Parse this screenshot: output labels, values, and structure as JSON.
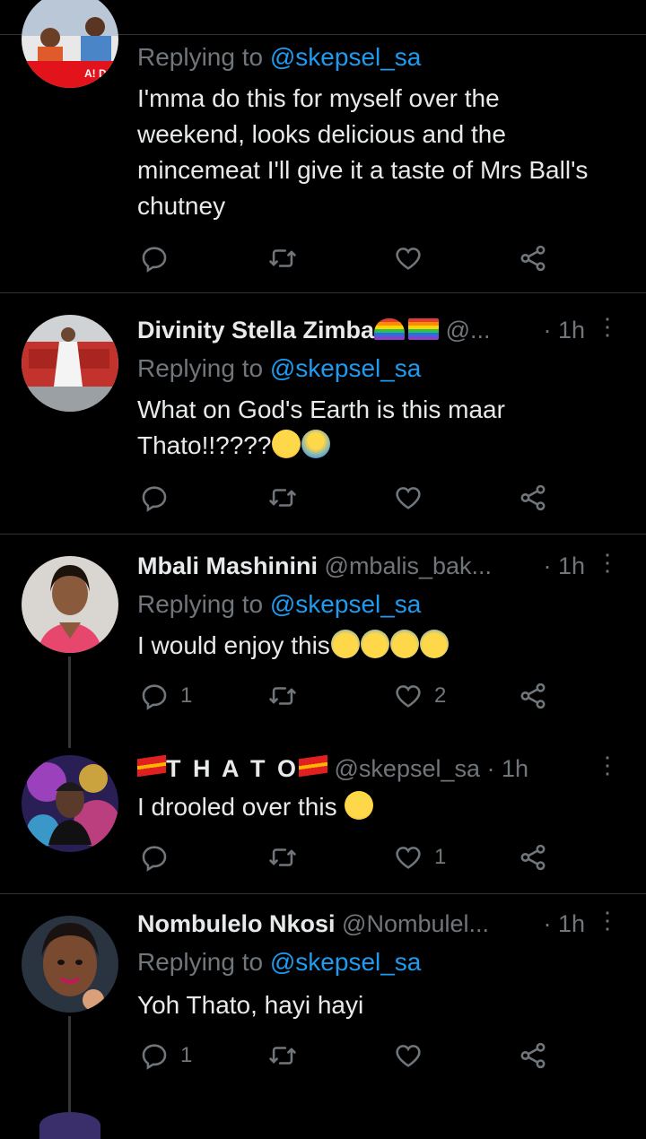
{
  "tweets": [
    {
      "reply_prefix": "Replying to ",
      "reply_handle": "@skepsel_sa",
      "text": "I'mma do this for myself over the weekend, looks delicious and the mincemeat I'll give it a taste of Mrs Ball's chutney",
      "text_lines": [
        "I'mma do this for myself over the",
        "weekend, looks delicious and the",
        "mincemeat I'll give it a taste of Mrs Ball's",
        "chutney"
      ],
      "avatar_text": "A! DAR"
    },
    {
      "name": "Divinity Stella Zimba",
      "handle": "@...",
      "time": "· 1h",
      "reply_prefix": "Replying to ",
      "reply_handle": "@skepsel_sa",
      "text_lines": [
        "What on God's Earth is this maar",
        "Thato!!????"
      ]
    },
    {
      "name": "Mbali Mashinini",
      "handle": "@mbalis_bak...",
      "time": "· 1h",
      "reply_prefix": "Replying to ",
      "reply_handle": "@skepsel_sa",
      "text": "I would enjoy this",
      "replies": "1",
      "likes": "2"
    },
    {
      "name": "T H A T O",
      "handle": "@skepsel_sa",
      "time": "· 1h",
      "text": "I drooled over this ",
      "likes": "1"
    },
    {
      "name": "Nombulelo Nkosi",
      "handle": "@Nombulel...",
      "time": "· 1h",
      "reply_prefix": "Replying to ",
      "reply_handle": "@skepsel_sa",
      "text": "Yoh Thato, hayi hayi",
      "replies": "1"
    }
  ],
  "icons": {
    "reply": "reply-icon",
    "retweet": "retweet-icon",
    "like": "heart-icon",
    "share": "share-icon",
    "more": "more-icon"
  },
  "colors": {
    "background": "#000000",
    "text": "#e7e9ea",
    "muted": "#71767b",
    "link": "#1d9bf0",
    "divider": "#2f3336"
  }
}
